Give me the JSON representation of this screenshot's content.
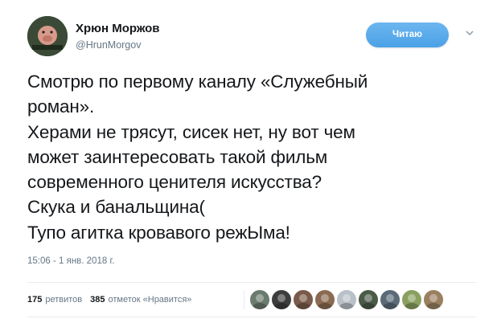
{
  "author": {
    "name": "Хрюн Моржов",
    "handle": "@HrunMorgov"
  },
  "follow_button": {
    "label": "Читаю"
  },
  "tweet": {
    "lines": [
      "Смотрю по первому каналу «Служебный",
      "роман».",
      "Херами не трясут, сисек нет, ну вот чем",
      "может заинтересовать такой фильм",
      "современного ценителя искусства?",
      "Скука и банальщина(",
      "Тупо агитка кровавого режЫма!"
    ],
    "timestamp": "15:06 - 1 янв. 2018 г."
  },
  "stats": {
    "retweets_count": "175",
    "retweets_label": "ретвитов",
    "likes_count": "385",
    "likes_label": "отметок «Нравится»"
  },
  "likers": [
    {
      "name": "liker-avatar-1",
      "color": "#6b7b6e"
    },
    {
      "name": "liker-avatar-2",
      "color": "#3d3d3d"
    },
    {
      "name": "liker-avatar-3",
      "color": "#7a5a4a"
    },
    {
      "name": "liker-avatar-4",
      "color": "#8a6a50"
    },
    {
      "name": "liker-avatar-5",
      "color": "#b8c0c8"
    },
    {
      "name": "liker-avatar-6",
      "color": "#4a5a48"
    },
    {
      "name": "liker-avatar-7",
      "color": "#5a6a78"
    },
    {
      "name": "liker-avatar-8",
      "color": "#8aa060"
    },
    {
      "name": "liker-avatar-9",
      "color": "#9a8060"
    }
  ],
  "colors": {
    "accent": "#4aa1e6",
    "text": "#14171a",
    "muted": "#657786"
  }
}
